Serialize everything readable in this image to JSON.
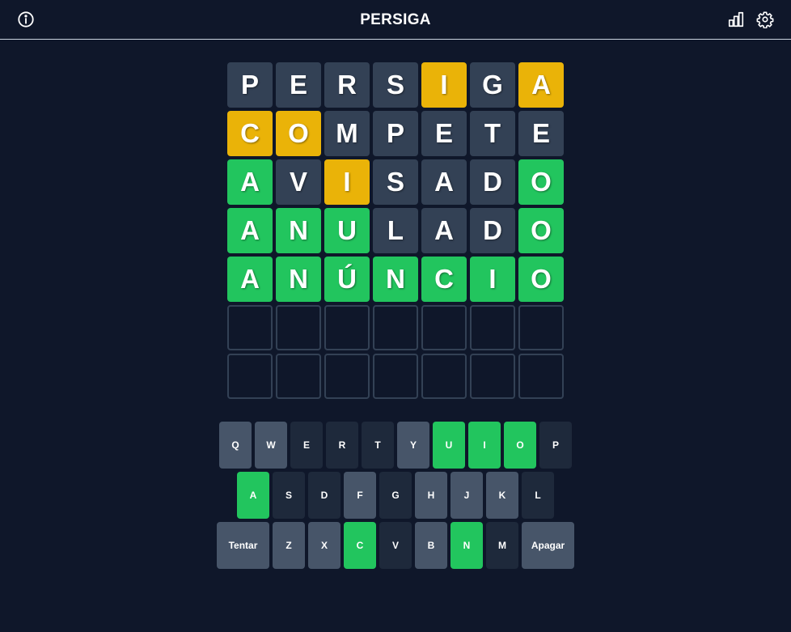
{
  "header": {
    "title": "PERSIGA",
    "icons": {
      "info": "info-icon",
      "stats": "bar-chart-icon",
      "settings": "gear-icon"
    }
  },
  "colors": {
    "background": "#0f172a",
    "absent": "#334155",
    "present": "#eab308",
    "correct": "#22c55e",
    "key_unused": "#475569",
    "key_absent": "#1e293b"
  },
  "board": [
    [
      {
        "letter": "P",
        "state": "absent"
      },
      {
        "letter": "E",
        "state": "absent"
      },
      {
        "letter": "R",
        "state": "absent"
      },
      {
        "letter": "S",
        "state": "absent"
      },
      {
        "letter": "I",
        "state": "present"
      },
      {
        "letter": "G",
        "state": "absent"
      },
      {
        "letter": "A",
        "state": "present"
      }
    ],
    [
      {
        "letter": "C",
        "state": "present"
      },
      {
        "letter": "O",
        "state": "present"
      },
      {
        "letter": "M",
        "state": "absent"
      },
      {
        "letter": "P",
        "state": "absent"
      },
      {
        "letter": "E",
        "state": "absent"
      },
      {
        "letter": "T",
        "state": "absent"
      },
      {
        "letter": "E",
        "state": "absent"
      }
    ],
    [
      {
        "letter": "A",
        "state": "correct"
      },
      {
        "letter": "V",
        "state": "absent"
      },
      {
        "letter": "I",
        "state": "present"
      },
      {
        "letter": "S",
        "state": "absent"
      },
      {
        "letter": "A",
        "state": "absent"
      },
      {
        "letter": "D",
        "state": "absent"
      },
      {
        "letter": "O",
        "state": "correct"
      }
    ],
    [
      {
        "letter": "A",
        "state": "correct"
      },
      {
        "letter": "N",
        "state": "correct"
      },
      {
        "letter": "U",
        "state": "correct"
      },
      {
        "letter": "L",
        "state": "absent"
      },
      {
        "letter": "A",
        "state": "absent"
      },
      {
        "letter": "D",
        "state": "absent"
      },
      {
        "letter": "O",
        "state": "correct"
      }
    ],
    [
      {
        "letter": "A",
        "state": "correct"
      },
      {
        "letter": "N",
        "state": "correct"
      },
      {
        "letter": "Ú",
        "state": "correct"
      },
      {
        "letter": "N",
        "state": "correct"
      },
      {
        "letter": "C",
        "state": "correct"
      },
      {
        "letter": "I",
        "state": "correct"
      },
      {
        "letter": "O",
        "state": "correct"
      }
    ],
    [
      {
        "letter": "",
        "state": "empty"
      },
      {
        "letter": "",
        "state": "empty"
      },
      {
        "letter": "",
        "state": "empty"
      },
      {
        "letter": "",
        "state": "empty"
      },
      {
        "letter": "",
        "state": "empty"
      },
      {
        "letter": "",
        "state": "empty"
      },
      {
        "letter": "",
        "state": "empty"
      }
    ],
    [
      {
        "letter": "",
        "state": "empty"
      },
      {
        "letter": "",
        "state": "empty"
      },
      {
        "letter": "",
        "state": "empty"
      },
      {
        "letter": "",
        "state": "empty"
      },
      {
        "letter": "",
        "state": "empty"
      },
      {
        "letter": "",
        "state": "empty"
      },
      {
        "letter": "",
        "state": "empty"
      }
    ]
  ],
  "keyboard": [
    [
      {
        "key": "Q",
        "state": "unused"
      },
      {
        "key": "W",
        "state": "unused"
      },
      {
        "key": "E",
        "state": "absent"
      },
      {
        "key": "R",
        "state": "absent"
      },
      {
        "key": "T",
        "state": "absent"
      },
      {
        "key": "Y",
        "state": "unused"
      },
      {
        "key": "U",
        "state": "correct"
      },
      {
        "key": "I",
        "state": "correct"
      },
      {
        "key": "O",
        "state": "correct"
      },
      {
        "key": "P",
        "state": "absent"
      }
    ],
    [
      {
        "key": "A",
        "state": "correct"
      },
      {
        "key": "S",
        "state": "absent"
      },
      {
        "key": "D",
        "state": "absent"
      },
      {
        "key": "F",
        "state": "unused"
      },
      {
        "key": "G",
        "state": "absent"
      },
      {
        "key": "H",
        "state": "unused"
      },
      {
        "key": "J",
        "state": "unused"
      },
      {
        "key": "K",
        "state": "unused"
      },
      {
        "key": "L",
        "state": "absent"
      }
    ],
    [
      {
        "key": "Tentar",
        "state": "unused",
        "wide": true
      },
      {
        "key": "Z",
        "state": "unused"
      },
      {
        "key": "X",
        "state": "unused"
      },
      {
        "key": "C",
        "state": "correct"
      },
      {
        "key": "V",
        "state": "absent"
      },
      {
        "key": "B",
        "state": "unused"
      },
      {
        "key": "N",
        "state": "correct"
      },
      {
        "key": "M",
        "state": "absent"
      },
      {
        "key": "Apagar",
        "state": "unused",
        "wide": true
      }
    ]
  ]
}
